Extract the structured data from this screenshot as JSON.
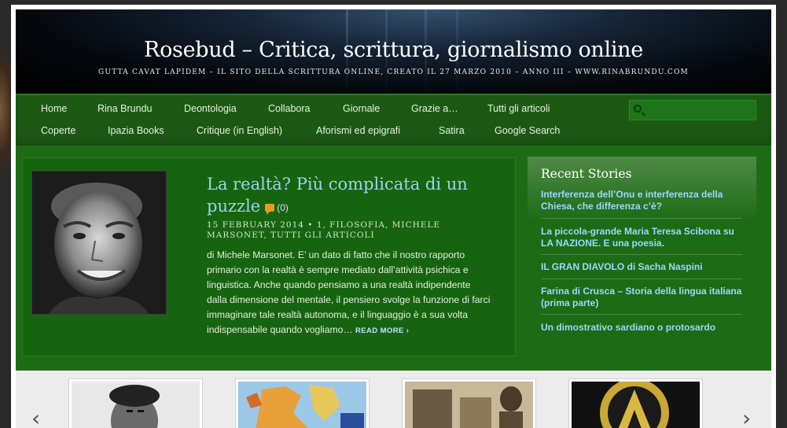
{
  "site": {
    "title": "Rosebud – Critica, scrittura, giornalismo online",
    "description": "Gutta cavat lapidem – il sito della scrittura online, creato il 27 marzo 2010 – anno III – www.rinabrundu.com"
  },
  "nav": {
    "row1": [
      "Home",
      "Rina Brundu",
      "Deontologia",
      "Collabora",
      "Giornale",
      "Grazie a…",
      "Tutti gli articoli"
    ],
    "row2": [
      "Coperte",
      "Ipazia Books",
      "Critique (in English)",
      "Aforismi ed epigrafi",
      "Satira",
      "Google Search"
    ],
    "search_placeholder": ""
  },
  "article": {
    "title": "La realtà? Più complicata di un puzzle",
    "comments": "(0)",
    "meta": "15 February 2014 • 1, Filosofia, Michele Marsonet, Tutti gli articoli",
    "excerpt": "di Michele Marsonet. E’ un dato di fatto che il nostro rapporto primario con la realtà è sempre mediato dall’attività psichica e linguistica. Anche quando pensiamo a una realtà indipendente dalla dimensione del mentale, il pensiero svolge la funzione di farci immaginare tale realtà autonoma, e il linguaggio è a sua volta indispensabile quando vogliamo…",
    "read_more": "Read More ›"
  },
  "sidebar": {
    "title": "Recent Stories",
    "stories": [
      "Interferenza dell’Onu e interferenza della Chiesa, che differenza c’è?",
      "La piccola-grande Maria Teresa Scibona su LA NAZIONE. E una poesia.",
      "IL GRAN DIAVOLO di Sacha Naspini",
      "Farina di Crusca – Storia della lingua italiana (prima parte)",
      "Un dimostrativo sardiano o protosardo"
    ]
  },
  "carousel": {
    "prev": "‹",
    "next": "›"
  },
  "colors": {
    "nav_green": "#1c5a14",
    "content_green": "#1e6b16",
    "link_blue": "#9fd6ff",
    "title_blue": "#9fd0ef"
  }
}
